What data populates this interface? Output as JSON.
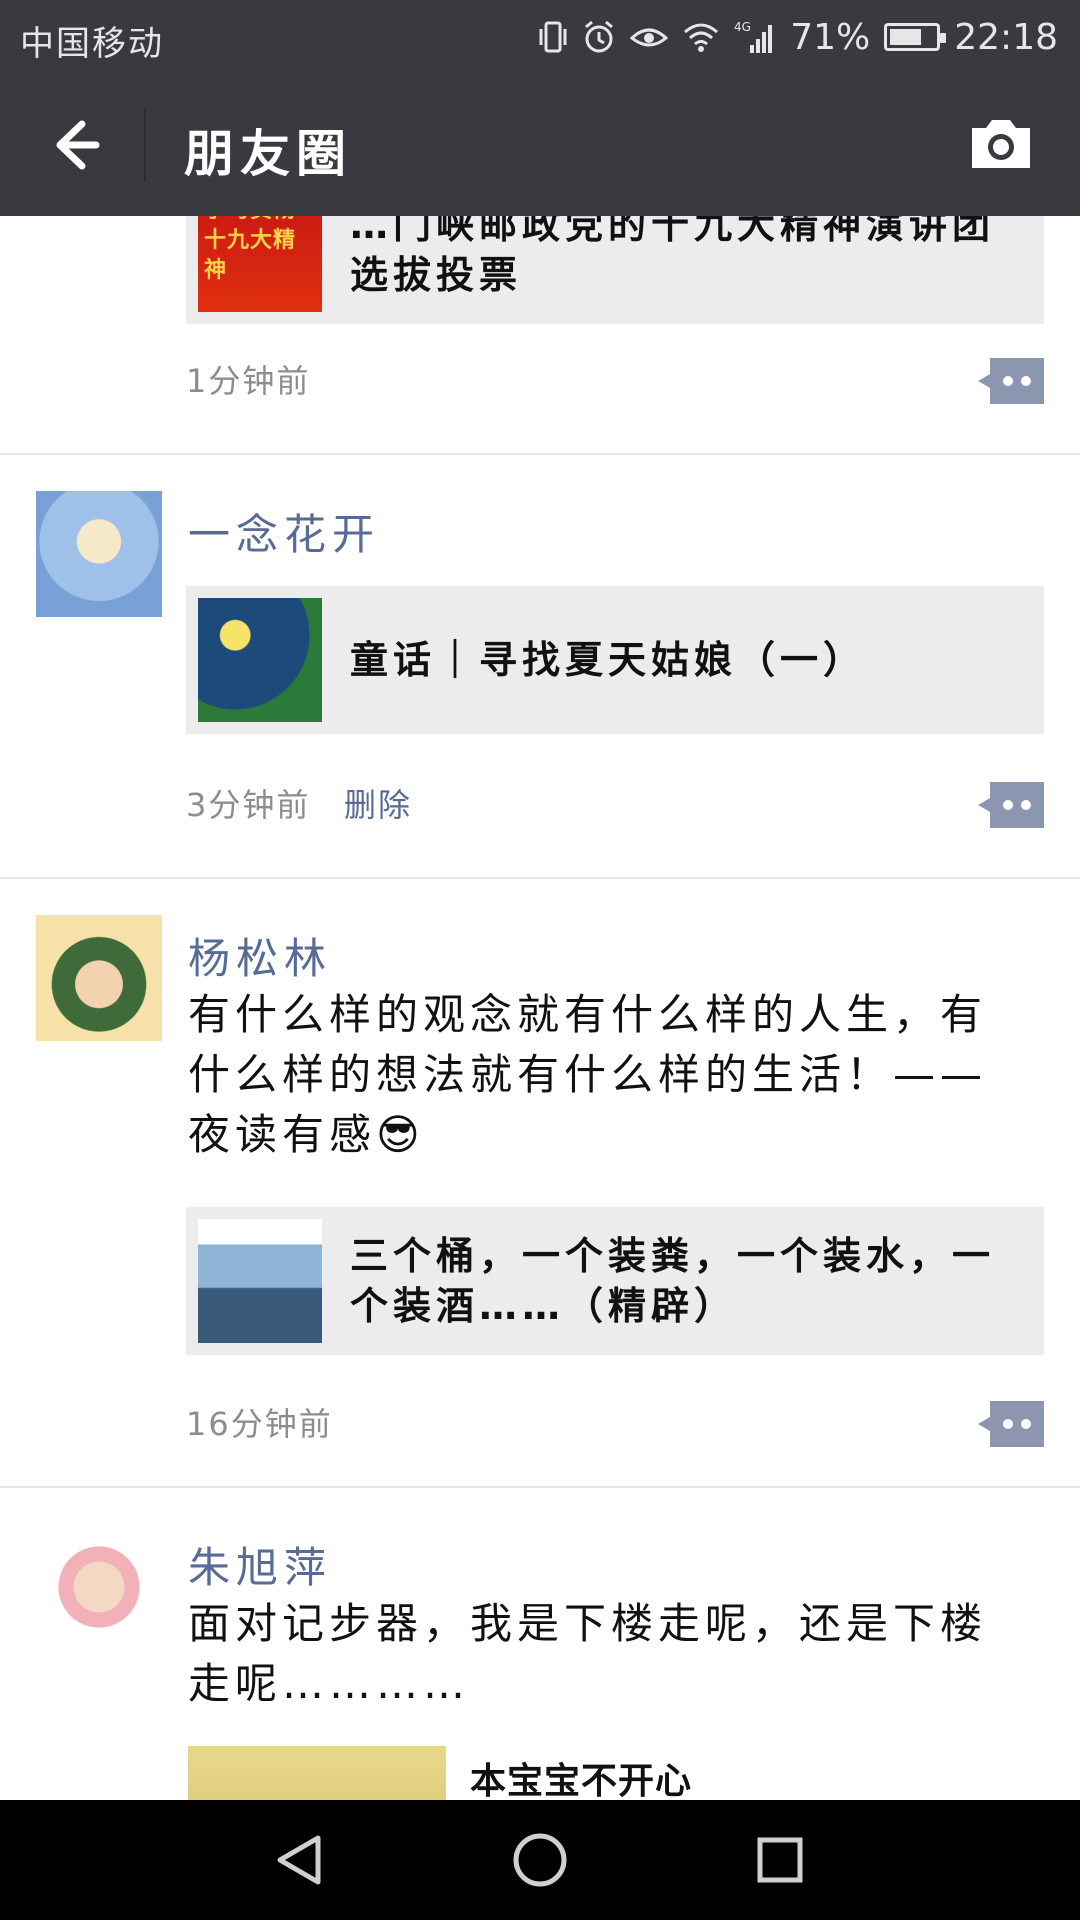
{
  "status_bar": {
    "carrier": "中国移动",
    "network": "4G",
    "battery_percent_text": "71%",
    "battery_level": 0.71,
    "time": "22:18",
    "icons": [
      "vibrate-icon",
      "alarm-icon",
      "eye-icon",
      "wifi-icon",
      "signal-icon",
      "battery-icon"
    ]
  },
  "nav": {
    "title": "朋友圈",
    "back_icon": "back-arrow-icon",
    "camera_icon": "camera-icon"
  },
  "posts": [
    {
      "link_title": "…门峡邮政党的十九大精神演讲团选拔投票",
      "link_thumb_text": "学习贯彻 十九大精神",
      "time": "1分钟前"
    },
    {
      "name": "一念花开",
      "link_title": "童话｜寻找夏天姑娘（一）",
      "time": "3分钟前",
      "delete_label": "删除"
    },
    {
      "name": "杨松林",
      "text": "有什么样的观念就有什么样的人生，有什么样的想法就有什么样的生活！——夜读有感😎",
      "link_title": "三个桶，一个装粪，一个装水，一个装酒……（精辟）",
      "time": "16分钟前"
    },
    {
      "name": "朱旭萍",
      "text": "面对记步器，我是下楼走呢，还是下楼走呢…………",
      "image_caption": "本宝宝不开心"
    }
  ],
  "bottom_nav": {
    "icons": [
      "back-triangle-icon",
      "home-circle-icon",
      "recents-square-icon"
    ]
  },
  "colors": {
    "bar": "#393a3f",
    "name": "#576b95",
    "card": "#ececec",
    "time": "#8d8d8d"
  }
}
